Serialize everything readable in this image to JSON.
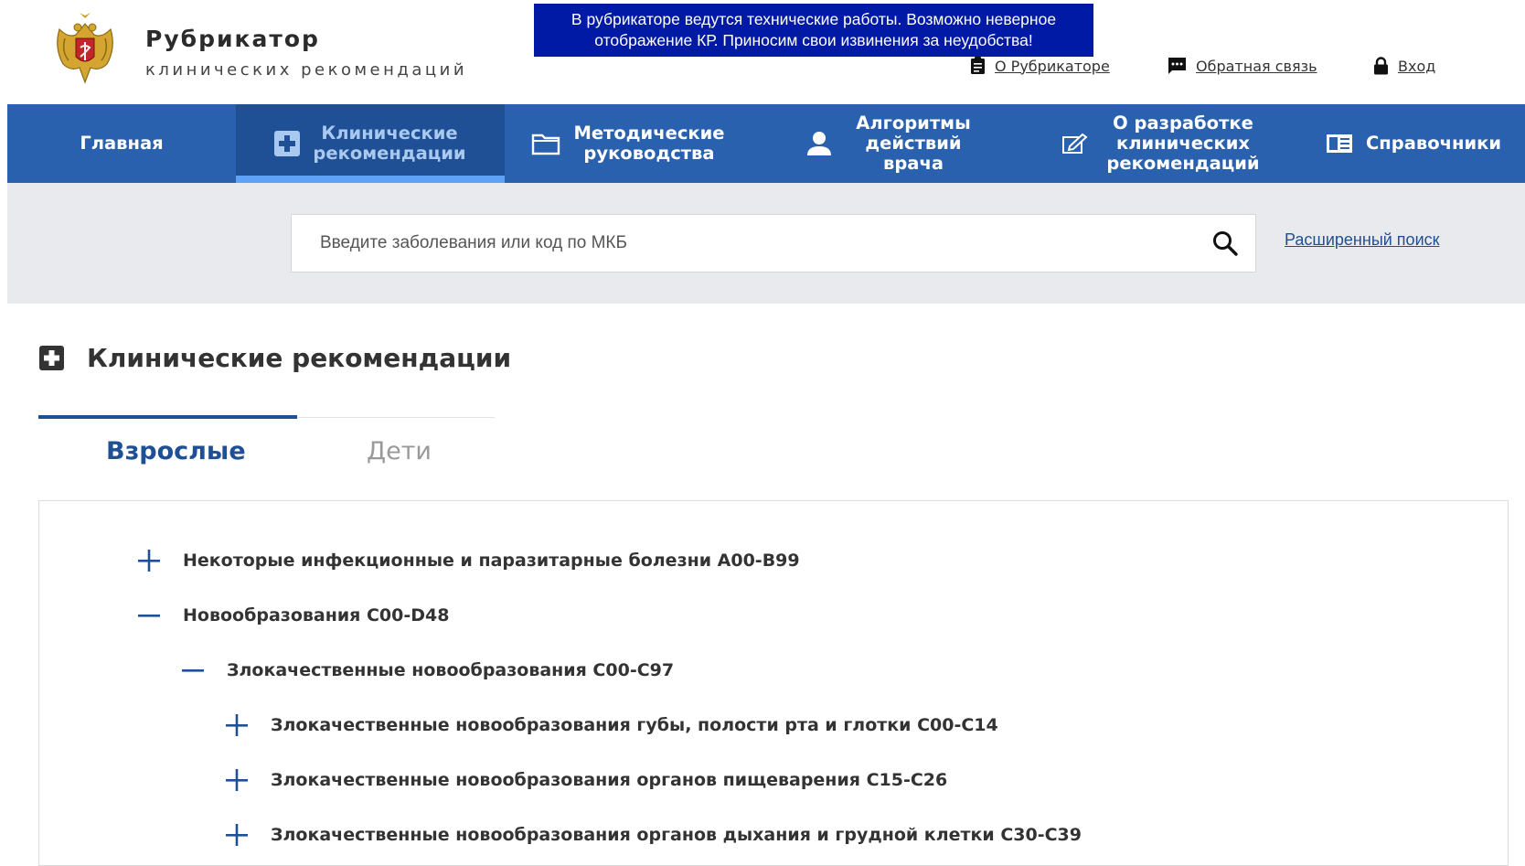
{
  "header": {
    "brand_title": "Рубрикатор",
    "brand_subtitle": "клинических рекомендаций",
    "notice_line1": "В рубрикаторе ведутся технические работы. Возможно неверное",
    "notice_line2": "отображение КР. Приносим свои извинения за неудобства!",
    "links": {
      "about": "О Рубрикаторе",
      "feedback": "Обратная связь",
      "login": "Вход"
    }
  },
  "nav": {
    "home": "Главная",
    "clinical_line1": "Клинические",
    "clinical_line2": "рекомендации",
    "methodical_line1": "Методические",
    "methodical_line2": "руководства",
    "algorithms_line1": "Алгоритмы",
    "algorithms_line2": "действий",
    "algorithms_line3": "врача",
    "development_line1": "О разработке",
    "development_line2": "клинических",
    "development_line3": "рекомендаций",
    "references": "Справочники"
  },
  "search": {
    "placeholder": "Введите заболевания или код по МКБ",
    "advanced_link": "Расширенный поиск"
  },
  "page": {
    "title": "Клинические рекомендации"
  },
  "tabs": {
    "adults": "Взрослые",
    "children": "Дети"
  },
  "tree": {
    "items": [
      {
        "label": "Некоторые инфекционные и паразитарные болезни А00-В99",
        "expanded": false,
        "level": 0
      },
      {
        "label": "Новообразования С00-D48",
        "expanded": true,
        "level": 0
      },
      {
        "label": "Злокачественные новообразования С00-С97",
        "expanded": true,
        "level": 1
      },
      {
        "label": "Злокачественные новообразования губы, полости рта и глотки С00-С14",
        "expanded": false,
        "level": 2
      },
      {
        "label": "Злокачественные новообразования органов пищеварения С15-С26",
        "expanded": false,
        "level": 2
      },
      {
        "label": "Злокачественные новообразования органов дыхания и грудной клетки С30-С39",
        "expanded": false,
        "level": 2
      }
    ]
  },
  "colors": {
    "nav_bg": "#2961ae",
    "nav_active_bg": "#1f4f94",
    "notice_bg": "#001aa5",
    "accent": "#1f4f94"
  }
}
